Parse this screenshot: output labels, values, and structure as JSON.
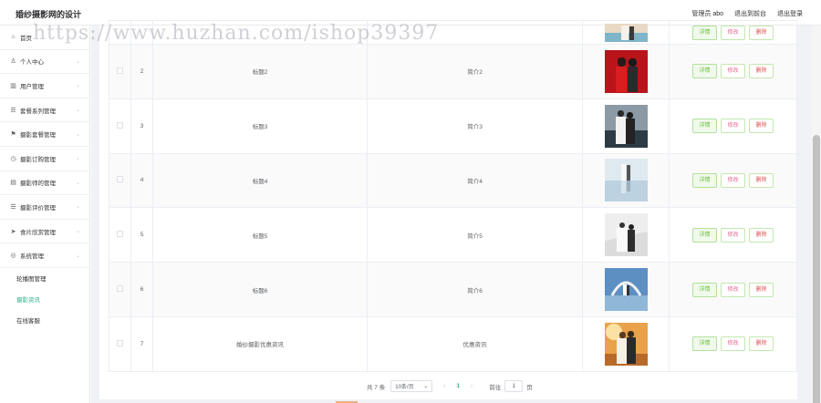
{
  "header": {
    "title": "婚纱摄影网的设计",
    "admin": "管理员 abo",
    "to_front": "退出到前台",
    "logout": "退出登录"
  },
  "watermark": "https://www.huzhan.com/ishop39397",
  "sidebar": {
    "items": [
      {
        "label": "首页",
        "icon": "home-icon",
        "glyph": "⌂"
      },
      {
        "label": "个人中心",
        "icon": "user-icon",
        "glyph": "♙"
      },
      {
        "label": "用户管理",
        "icon": "bar-chart-icon",
        "glyph": "▥"
      },
      {
        "label": "套餐系列管理",
        "icon": "list-icon",
        "glyph": "☰"
      },
      {
        "label": "摄影套餐管理",
        "icon": "flag-icon",
        "glyph": "⚑"
      },
      {
        "label": "摄影订购管理",
        "icon": "clock-icon",
        "glyph": "◷"
      },
      {
        "label": "摄影师的管理",
        "icon": "chart-icon",
        "glyph": "▤"
      },
      {
        "label": "摄影评价管理",
        "icon": "menu-icon",
        "glyph": "☰"
      },
      {
        "label": "食片欣赏管理",
        "icon": "send-icon",
        "glyph": "➤"
      },
      {
        "label": "系统管理",
        "icon": "settings-icon",
        "glyph": "◎"
      }
    ],
    "sub_items": [
      {
        "label": "轮播图管理",
        "active": false
      },
      {
        "label": "摄影资讯",
        "active": true
      },
      {
        "label": "在线客服",
        "active": false
      }
    ]
  },
  "table": {
    "rows": [
      {
        "index": "2",
        "title": "标题2",
        "intro": "简介2",
        "photo": "photo-red-couple"
      },
      {
        "index": "3",
        "title": "标题3",
        "intro": "简介3",
        "photo": "photo-car-couple"
      },
      {
        "index": "4",
        "title": "标题4",
        "intro": "简介4",
        "photo": "photo-water-couple"
      },
      {
        "index": "5",
        "title": "标题5",
        "intro": "简介5",
        "photo": "photo-white-room"
      },
      {
        "index": "6",
        "title": "标题6",
        "intro": "简介6",
        "photo": "photo-blue-arch"
      },
      {
        "index": "7",
        "title": "婚纱摄影优惠资讯",
        "intro": "优惠资讯",
        "photo": "photo-sunset-couple"
      }
    ],
    "btn_detail": "详情",
    "btn_edit": "修改",
    "btn_delete": "删除"
  },
  "pager": {
    "total": "共 7 条",
    "page_size": "10条/页",
    "current_page": "1",
    "goto_label": "前往",
    "goto_value": "1",
    "page_unit": "页"
  },
  "colors": {
    "accent": "#30b08f",
    "detail": "#67c23a",
    "edit": "#e26a8e",
    "delete": "#d9534f"
  }
}
